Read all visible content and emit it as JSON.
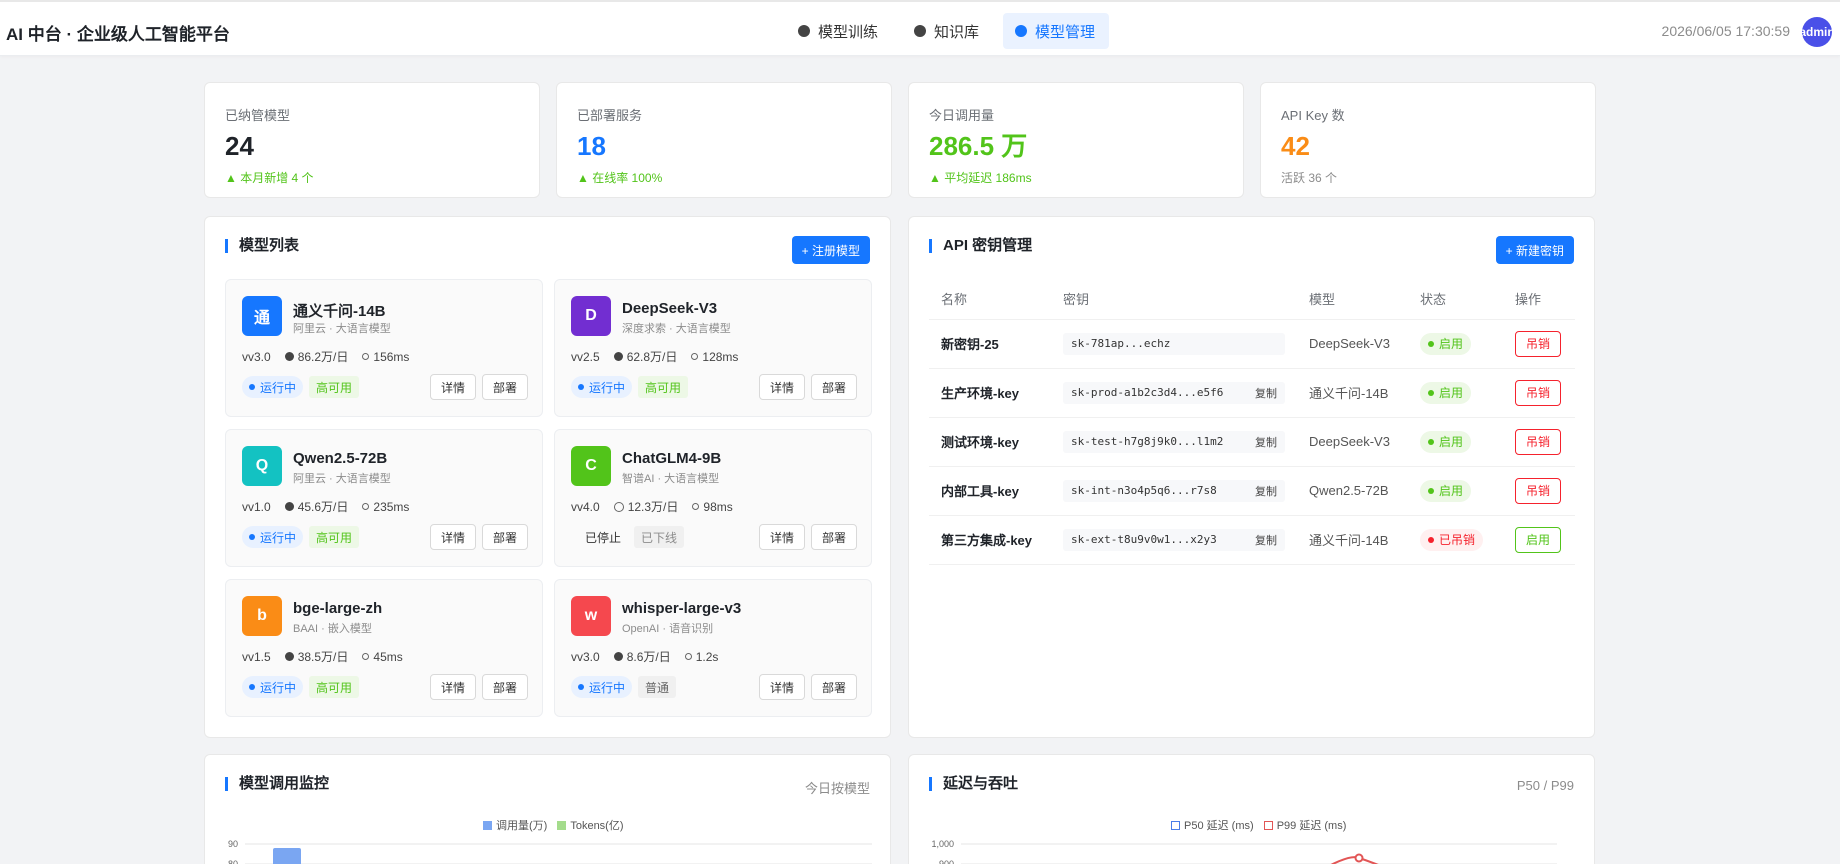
{
  "header": {
    "brand": "AI 中台 · 企业级人工智能平台",
    "nav": [
      {
        "label": "模型训练",
        "active": false
      },
      {
        "label": "知识库",
        "active": false
      },
      {
        "label": "模型管理",
        "active": true
      }
    ],
    "clock": "2026/06/05 17:30:59",
    "avatar_text": "admin"
  },
  "stats": [
    {
      "label": "已纳管模型",
      "value": "24",
      "sub": "▲ 本月新增 4 个",
      "color": "#1f2329"
    },
    {
      "label": "已部署服务",
      "value": "18",
      "sub": "▲ 在线率 100%",
      "color": "#1677ff"
    },
    {
      "label": "今日调用量",
      "value": "286.5 万",
      "sub": "▲ 平均延迟 186ms",
      "color": "#52c41a"
    },
    {
      "label": "API Key 数",
      "value": "42",
      "sub": "活跃 36 个",
      "color": "#fa8c16"
    }
  ],
  "models_panel": {
    "title": "模型列表",
    "add_button": "+ 注册模型",
    "detail_label": "详情",
    "deploy_label": "部署",
    "models": [
      {
        "initial": "通",
        "color": "#1677ff",
        "name": "通义千问-14B",
        "sub": "阿里云 · 大语言模型",
        "version": "vv3.0",
        "calls": "86.2万/日",
        "latency": "156ms",
        "status": "运行中",
        "tag": "高可用"
      },
      {
        "initial": "D",
        "color": "#722ed1",
        "name": "DeepSeek-V3",
        "sub": "深度求索 · 大语言模型",
        "version": "vv2.5",
        "calls": "62.8万/日",
        "latency": "128ms",
        "status": "运行中",
        "tag": "高可用"
      },
      {
        "initial": "Q",
        "color": "#13c2c2",
        "name": "Qwen2.5-72B",
        "sub": "阿里云 · 大语言模型",
        "version": "vv1.0",
        "calls": "45.6万/日",
        "latency": "235ms",
        "status": "运行中",
        "tag": "高可用"
      },
      {
        "initial": "C",
        "color": "#52c41a",
        "name": "ChatGLM4-9B",
        "sub": "智谱AI · 大语言模型",
        "version": "vv4.0",
        "calls": "12.3万/日",
        "latency": "98ms",
        "status": "已停止",
        "tag": "已下线"
      },
      {
        "initial": "b",
        "color": "#fa8c16",
        "name": "bge-large-zh",
        "sub": "BAAI · 嵌入模型",
        "version": "vv1.5",
        "calls": "38.5万/日",
        "latency": "45ms",
        "status": "运行中",
        "tag": "高可用"
      },
      {
        "initial": "w",
        "color": "#f5484e",
        "name": "whisper-large-v3",
        "sub": "OpenAI · 语音识别",
        "version": "vv3.0",
        "calls": "8.6万/日",
        "latency": "1.2s",
        "status": "运行中",
        "tag": "普通"
      }
    ]
  },
  "api_panel": {
    "title": "API 密钥管理",
    "add_button": "+ 新建密钥",
    "columns": [
      "名称",
      "密钥",
      "模型",
      "状态",
      "操作"
    ],
    "copy_label": "复制",
    "rows": [
      {
        "name": "新密钥-25",
        "key": "sk-781ap...echz",
        "copy": false,
        "model": "DeepSeek-V3",
        "status": "启用",
        "action": "吊销"
      },
      {
        "name": "生产环境-key",
        "key": "sk-prod-a1b2c3d4...e5f6",
        "copy": true,
        "model": "通义千问-14B",
        "status": "启用",
        "action": "吊销"
      },
      {
        "name": "测试环境-key",
        "key": "sk-test-h7g8j9k0...l1m2",
        "copy": true,
        "model": "DeepSeek-V3",
        "status": "启用",
        "action": "吊销"
      },
      {
        "name": "内部工具-key",
        "key": "sk-int-n3o4p5q6...r7s8",
        "copy": true,
        "model": "Qwen2.5-72B",
        "status": "启用",
        "action": "吊销"
      },
      {
        "name": "第三方集成-key",
        "key": "sk-ext-t8u9v0w1...x2y3",
        "copy": true,
        "model": "通义千问-14B",
        "status": "已吊销",
        "action": "启用"
      }
    ]
  },
  "monitor_panel": {
    "title": "模型调用监控",
    "hint": "今日按模型",
    "legend": [
      "调用量(万)",
      "Tokens(亿)"
    ],
    "y_ticks": [
      "90",
      "80"
    ]
  },
  "latency_panel": {
    "title": "延迟与吞吐",
    "hint": "P50 / P99",
    "legend": [
      "P50 延迟 (ms)",
      "P99 延迟 (ms)"
    ],
    "y_ticks": [
      "1,000",
      "900"
    ]
  }
}
